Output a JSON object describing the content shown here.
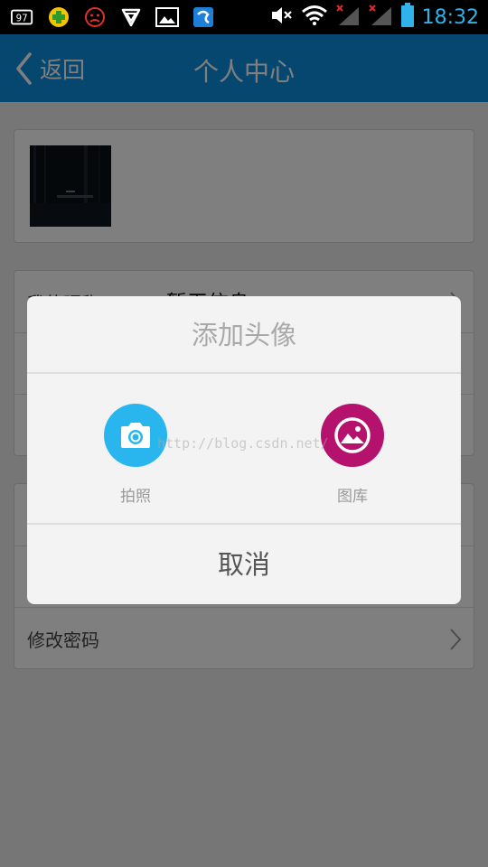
{
  "status_bar": {
    "time": "18:32",
    "notification_icons": [
      "sim-97-icon",
      "game-icon",
      "sad-face-icon",
      "shield-icon",
      "image-icon",
      "app-icon"
    ],
    "system_icons": [
      "mute-icon",
      "wifi-icon",
      "signal-1-icon",
      "signal-2-icon",
      "battery-icon"
    ],
    "time_color": "#2fb3e8"
  },
  "header": {
    "back_label": "返回",
    "title": "个人中心",
    "background": "#0c8ee0"
  },
  "profile": {
    "rows_group1": [
      {
        "label": "我的昵称",
        "value": "暂无信息"
      },
      {
        "label": "",
        "value": ""
      },
      {
        "label": "",
        "value": ""
      }
    ],
    "rows_group2": [
      {
        "label": ""
      },
      {
        "label": ""
      },
      {
        "label": "修改密码"
      }
    ]
  },
  "dialog": {
    "title": "添加头像",
    "options": [
      {
        "label": "拍照",
        "icon": "camera-icon",
        "color": "#29b6ee"
      },
      {
        "label": "图库",
        "icon": "gallery-icon",
        "color": "#b4126c"
      }
    ],
    "cancel_label": "取消",
    "watermark": "http://blog.csdn.net/"
  }
}
